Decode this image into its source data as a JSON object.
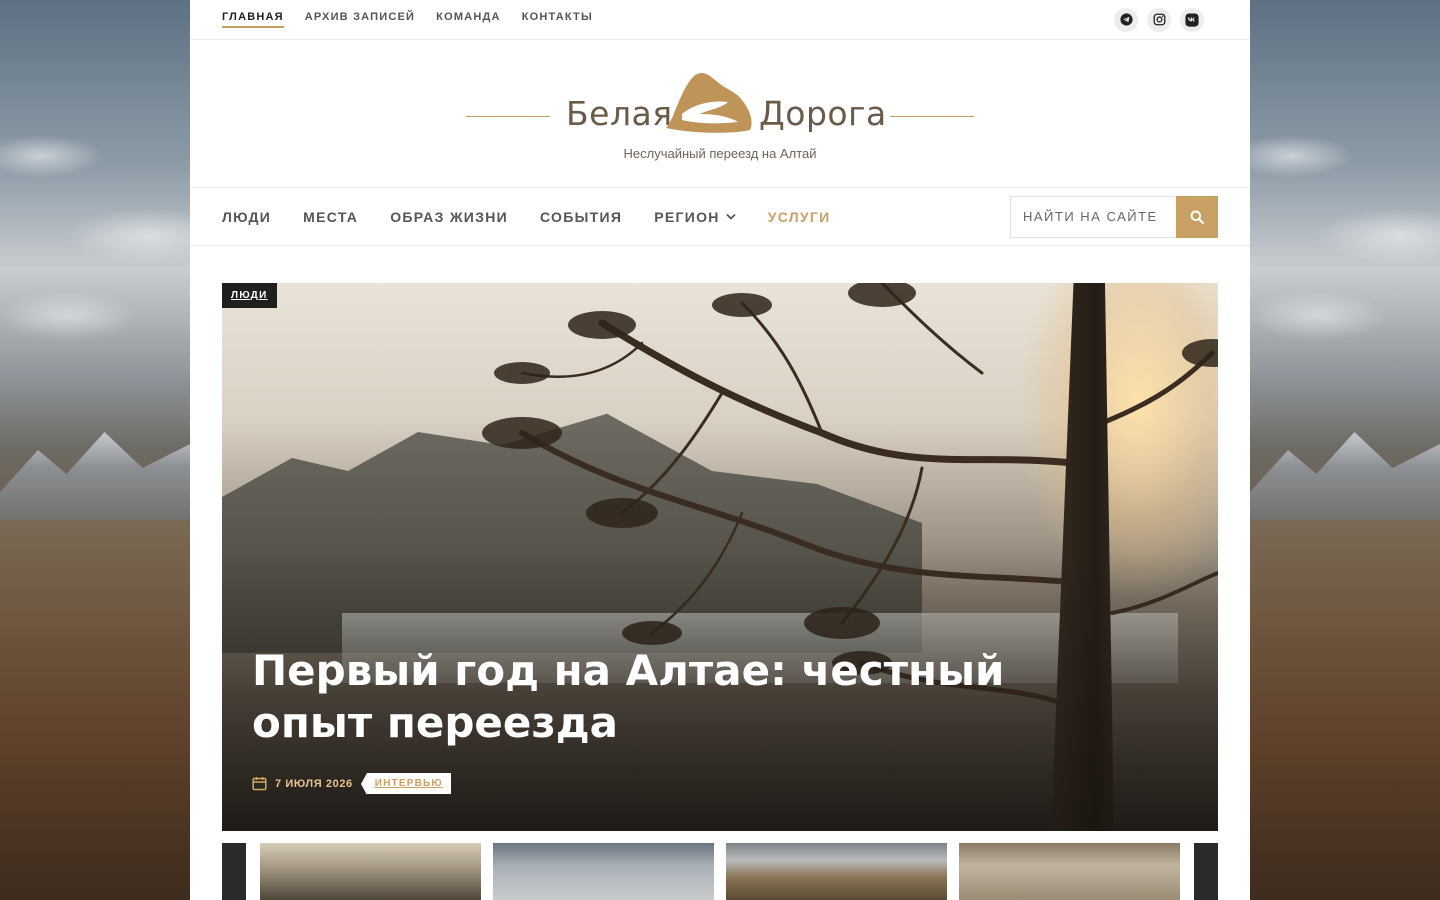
{
  "topnav": {
    "items": [
      {
        "label": "ГЛАВНАЯ",
        "active": true
      },
      {
        "label": "АРХИВ ЗАПИСЕЙ"
      },
      {
        "label": "КОМАНДА"
      },
      {
        "label": "КОНТАКТЫ"
      }
    ]
  },
  "social": [
    "telegram-icon",
    "instagram-icon",
    "vk-icon"
  ],
  "brand": {
    "word1": "Белая",
    "word2": "Дорога",
    "tagline": "Неслучайный переезд на Алтай",
    "accent_color": "#c9a063"
  },
  "menu": {
    "items": [
      {
        "label": "ЛЮДИ"
      },
      {
        "label": "МЕСТА"
      },
      {
        "label": "ОБРАЗ ЖИЗНИ"
      },
      {
        "label": "СОБЫТИЯ"
      },
      {
        "label": "РЕГИОН",
        "has_dropdown": true
      },
      {
        "label": "УСЛУГИ",
        "accent": true
      }
    ]
  },
  "search": {
    "placeholder": "НАЙТИ НА САЙТЕ"
  },
  "hero": {
    "category": "ЛЮДИ",
    "title": "Первый год на Алтае: честный опыт переезда",
    "date": "7 ИЮЛЯ 2026",
    "tag": "ИНТЕРВЬЮ"
  }
}
